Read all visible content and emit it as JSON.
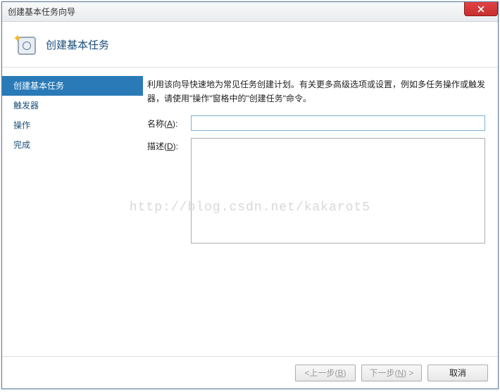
{
  "window": {
    "title": "创建基本任务向导"
  },
  "header": {
    "title": "创建基本任务"
  },
  "sidebar": {
    "items": [
      {
        "label": "创建基本任务",
        "active": true
      },
      {
        "label": "触发器",
        "active": false
      },
      {
        "label": "操作",
        "active": false
      },
      {
        "label": "完成",
        "active": false
      }
    ]
  },
  "main": {
    "intro": "利用该向导快速地为常见任务创建计划。有关更多高级选项或设置，例如多任务操作或触发器，请使用\"操作\"窗格中的\"创建任务\"命令。",
    "name_label_prefix": "名称(",
    "name_label_key": "A",
    "name_label_suffix": "):",
    "name_value": "",
    "desc_label_prefix": "描述(",
    "desc_label_key": "D",
    "desc_label_suffix": "):",
    "desc_value": ""
  },
  "footer": {
    "back_prefix": "<上一步(",
    "back_key": "B",
    "back_suffix": ")",
    "next_prefix": "下一步(",
    "next_key": "N",
    "next_suffix": ") >",
    "cancel": "取消"
  },
  "watermark": "http://blog.csdn.net/kakarot5"
}
